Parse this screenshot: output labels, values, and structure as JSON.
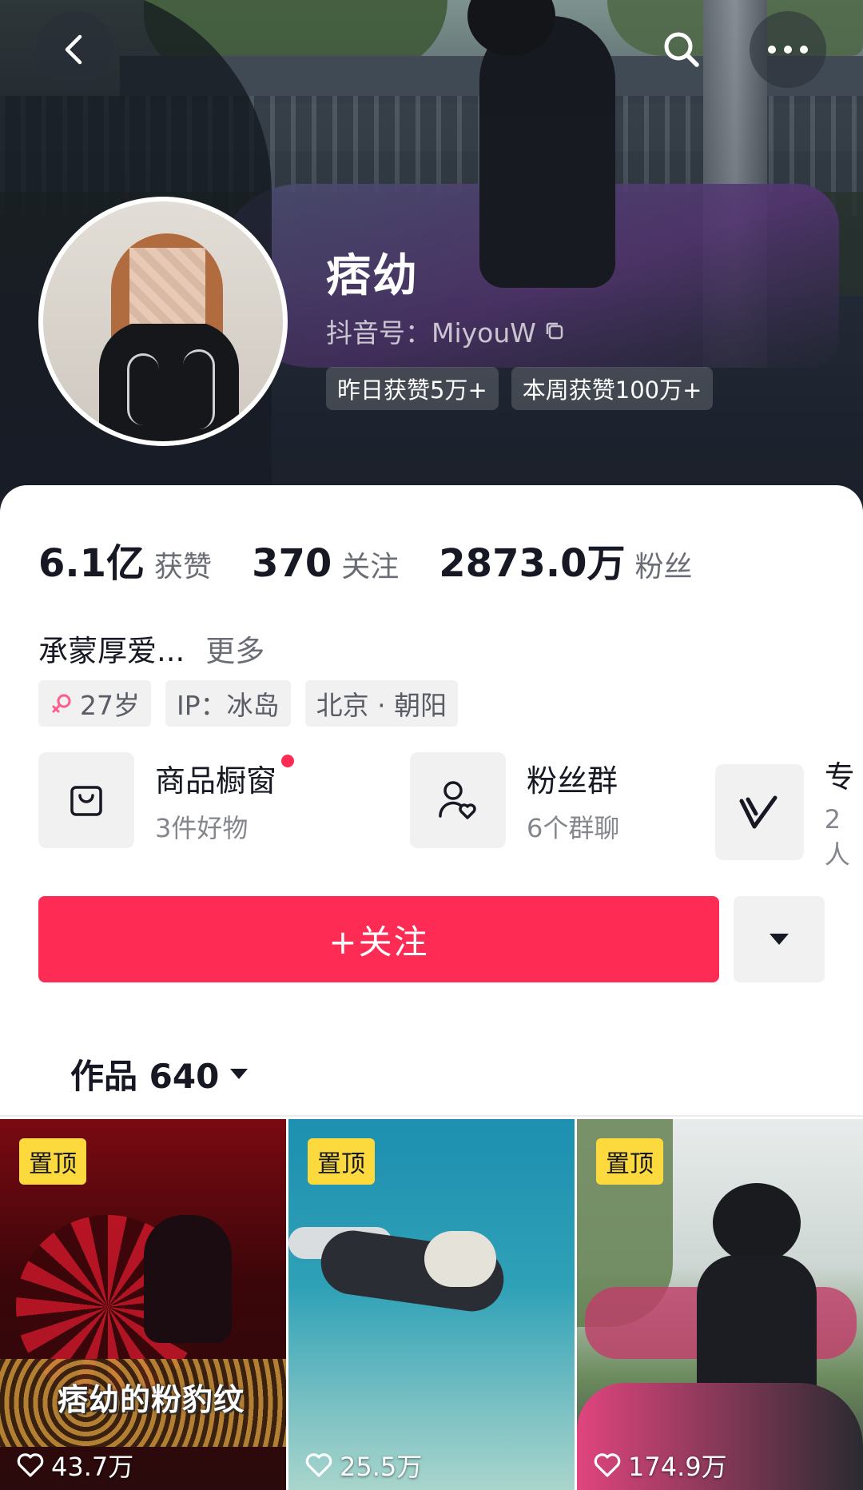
{
  "header": {
    "name": "痞幼",
    "douyin_id": "抖音号：MiyouW",
    "badges": [
      "昨日获赞5万+",
      "本周获赞100万+"
    ]
  },
  "stats": [
    {
      "value": "6.1亿",
      "label": "获赞"
    },
    {
      "value": "370",
      "label": "关注"
    },
    {
      "value": "2873.0万",
      "label": "粉丝"
    }
  ],
  "bio": {
    "text": "承蒙厚爱...",
    "more": "更多"
  },
  "chips": {
    "age": "27岁",
    "ip": "IP：冰岛",
    "location": "北京 · 朝阳"
  },
  "entries": [
    {
      "title": "商品橱窗",
      "subtitle": "3件好物",
      "icon": "shopping-bag-icon",
      "has_dot": true
    },
    {
      "title": "粉丝群",
      "subtitle": "6个群聊",
      "icon": "user-heart-icon",
      "has_dot": false
    },
    {
      "title": "专",
      "subtitle": "2人",
      "icon": "v-logo-icon",
      "has_dot": false
    }
  ],
  "actions": {
    "follow": "+关注"
  },
  "works": {
    "label": "作品 640"
  },
  "videos": [
    {
      "pin": "置顶",
      "likes": "43.7万",
      "overlay": "痞幼的粉豹纹"
    },
    {
      "pin": "置顶",
      "likes": "25.5万"
    },
    {
      "pin": "置顶",
      "likes": "174.9万"
    }
  ],
  "colors": {
    "accent": "#fe2c55",
    "pin": "#fcd93c"
  }
}
